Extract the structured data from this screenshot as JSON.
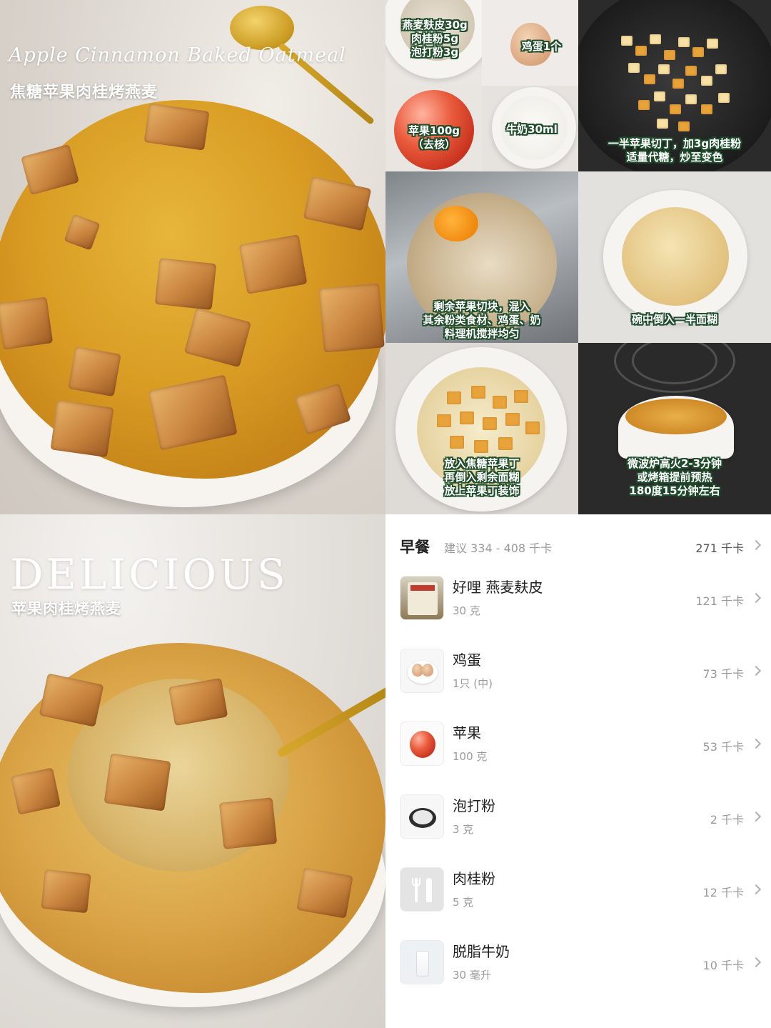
{
  "hero": {
    "script_title": "Apple Cinnamon Baked Oatmeal",
    "cn_title": "焦糖苹果肉桂烤燕麦"
  },
  "steps": [
    {
      "id": "ingredients-dry",
      "lines": [
        "燕麦麸皮30g",
        "肉桂粉5g",
        "泡打粉3g"
      ]
    },
    {
      "id": "egg",
      "lines": [
        "鸡蛋1个"
      ]
    },
    {
      "id": "apple",
      "lines": [
        "苹果100g",
        "（去核）"
      ]
    },
    {
      "id": "milk",
      "lines": [
        "牛奶30ml"
      ]
    },
    {
      "id": "caramelize",
      "lines": [
        "一半苹果切丁，加3g肉桂粉",
        "适量代糖，炒至变色"
      ]
    },
    {
      "id": "blend",
      "lines": [
        "剩余苹果切块，混入",
        "其余粉类食材、鸡蛋、奶",
        "料理机搅拌均匀"
      ]
    },
    {
      "id": "pour-half",
      "lines": [
        "碗中倒入一半面糊"
      ]
    },
    {
      "id": "layer",
      "lines": [
        "放入焦糖苹果丁",
        "再倒入剩余面糊",
        "放上苹果丁装饰"
      ]
    },
    {
      "id": "bake",
      "lines": [
        "微波炉高火2-3分钟",
        "或烤箱提前预热",
        "180度15分钟左右"
      ]
    }
  ],
  "hero_bottom": {
    "big_title": "DELICIOUS",
    "sub_title": "苹果肉桂烤燕麦"
  },
  "nutrition": {
    "meal_name": "早餐",
    "suggestion": "建议 334 - 408 千卡",
    "total": "271 千卡",
    "items": [
      {
        "name": "好哩 燕麦麸皮",
        "amount": "30 克",
        "kcal": "121 千卡",
        "icon": "oat-bran-package-icon"
      },
      {
        "name": "鸡蛋",
        "amount": "1只 (中)",
        "kcal": "73 千卡",
        "icon": "eggs-icon"
      },
      {
        "name": "苹果",
        "amount": "100 克",
        "kcal": "53 千卡",
        "icon": "apple-icon"
      },
      {
        "name": "泡打粉",
        "amount": "3 克",
        "kcal": "2 千卡",
        "icon": "baking-powder-icon"
      },
      {
        "name": "肉桂粉",
        "amount": "5 克",
        "kcal": "12 千卡",
        "icon": "fork-knife-icon"
      },
      {
        "name": "脱脂牛奶",
        "amount": "30 毫升",
        "kcal": "10 千卡",
        "icon": "milk-glass-icon"
      }
    ]
  }
}
